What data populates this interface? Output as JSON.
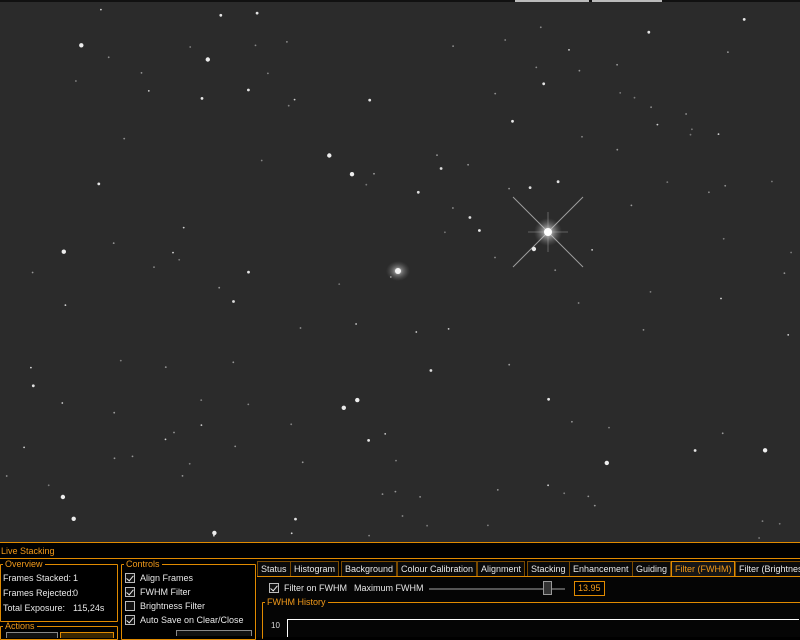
{
  "panel": {
    "title": "Live Stacking"
  },
  "overview": {
    "legend": "Overview",
    "rows": [
      {
        "label": "Frames Stacked:",
        "value": "1"
      },
      {
        "label": "Frames Rejected:",
        "value": "0"
      },
      {
        "label": "Total Exposure:",
        "value": "115,24s"
      }
    ]
  },
  "actions": {
    "legend": "Actions"
  },
  "controls": {
    "legend": "Controls",
    "checkboxes": [
      {
        "label": "Align Frames",
        "checked": true
      },
      {
        "label": "FWHM Filter",
        "checked": true
      },
      {
        "label": "Brightness Filter",
        "checked": false
      },
      {
        "label": "Auto Save on Clear/Close",
        "checked": true
      }
    ]
  },
  "tabs": [
    "Status",
    "Histogram",
    "Background",
    "Colour Calibration",
    "Alignment",
    "Stacking",
    "Enhancement",
    "Guiding",
    "Filter (FWHM)",
    "Filter (Brightness)"
  ],
  "active_tab": "Filter (FWHM)",
  "fwhm": {
    "filter_label": "Filter on FWHM",
    "filter_checked": true,
    "max_label": "Maximum FWHM",
    "max_value": "13.95",
    "slider_fraction": 0.87,
    "history_legend": "FWHM History",
    "axis_tick": "10"
  },
  "colors": {
    "accent": "#e08a00",
    "sky": "#2b2b2b"
  }
}
